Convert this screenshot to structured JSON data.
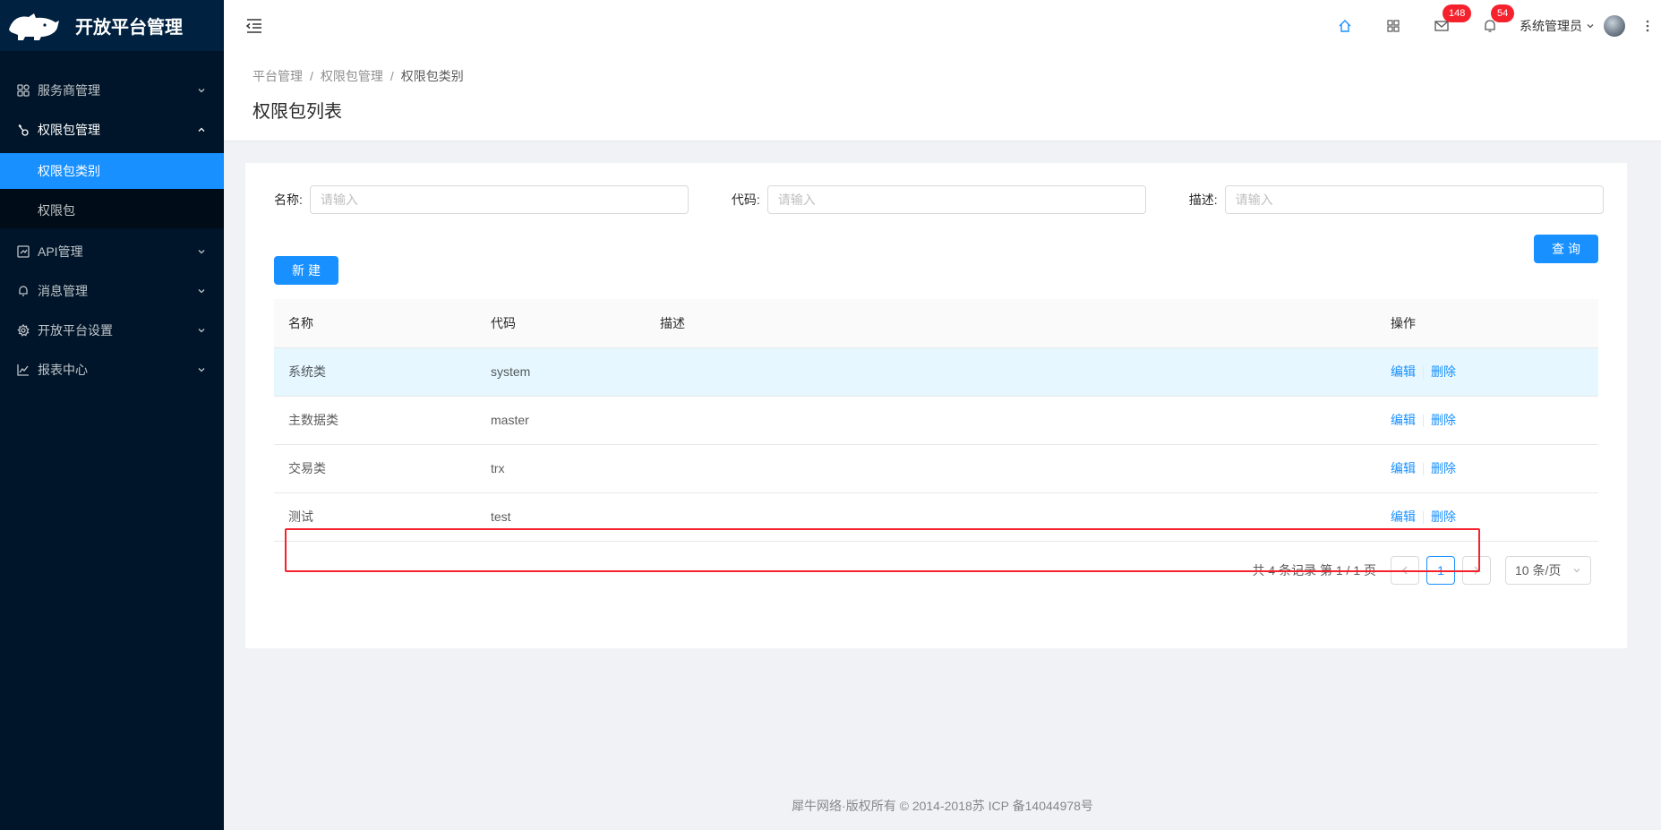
{
  "app": {
    "title": "开放平台管理"
  },
  "sidebar": {
    "items": [
      {
        "label": "服务商管理",
        "icon": "appstore-icon"
      },
      {
        "label": "权限包管理",
        "icon": "key-icon",
        "open": true,
        "children": [
          {
            "label": "权限包类别",
            "active": true
          },
          {
            "label": "权限包"
          }
        ]
      },
      {
        "label": "API管理",
        "icon": "api-icon"
      },
      {
        "label": "消息管理",
        "icon": "bell-icon"
      },
      {
        "label": "开放平台设置",
        "icon": "setting-icon"
      },
      {
        "label": "报表中心",
        "icon": "line-chart-icon"
      }
    ]
  },
  "header": {
    "mail_count": "148",
    "notice_count": "54",
    "user_name": "系统管理员"
  },
  "breadcrumb": [
    "平台管理",
    "权限包管理",
    "权限包类别"
  ],
  "page_title": "权限包列表",
  "search": {
    "name_label": "名称:",
    "name_placeholder": "请输入",
    "code_label": "代码:",
    "code_placeholder": "请输入",
    "desc_label": "描述:",
    "desc_placeholder": "请输入",
    "query_button": "查询",
    "new_button": "新建"
  },
  "table": {
    "columns": [
      "名称",
      "代码",
      "描述",
      "操作"
    ],
    "rows": [
      {
        "name": "系统类",
        "code": "system",
        "desc": ""
      },
      {
        "name": "主数据类",
        "code": "master",
        "desc": ""
      },
      {
        "name": "交易类",
        "code": "trx",
        "desc": ""
      },
      {
        "name": "测试",
        "code": "test",
        "desc": ""
      }
    ],
    "edit_label": "编辑",
    "delete_label": "删除"
  },
  "pagination": {
    "total_text": "共 4 条记录 第 1 / 1 页",
    "current_page": "1",
    "page_size": "10 条/页"
  },
  "footer": {
    "text": "犀牛网络·版权所有 © 2014-2018苏 ICP 备14044978号"
  },
  "colors": {
    "primary": "#1890ff",
    "sidebar": "#001529",
    "highlight": "#f5222d"
  }
}
